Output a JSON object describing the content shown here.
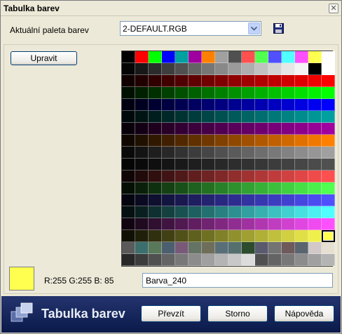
{
  "window": {
    "title": "Tabulka barev",
    "close_icon": "close-icon"
  },
  "palette": {
    "label": "Aktuální paleta barev",
    "value": "2-DEFAULT.RGB",
    "save_icon": "floppy-disk-icon"
  },
  "edit_button": "Upravit",
  "grid": {
    "columns": 16,
    "rows": 18,
    "colors": [
      [
        "#000000",
        "#ff0000",
        "#00ff00",
        "#0000ff",
        "#00a0a0",
        "#a000a0",
        "#ff8000",
        "#a0a0a0",
        "#505050",
        "#ff5050",
        "#50ff50",
        "#5050ff",
        "#50ffff",
        "#ff50ff",
        "#ffff50",
        "#ffffff"
      ],
      [
        "#050505",
        "#181818",
        "#2b2b2b",
        "#3d3d3d",
        "#505050",
        "#636363",
        "#767676",
        "#888888",
        "#9b9b9b",
        "#aeaeae",
        "#c1c1c1",
        "#d3d3d3",
        "#e6e6e6",
        "#f4f4f4",
        "#000000",
        "#ffffff"
      ],
      [
        "#100000",
        "#200000",
        "#300000",
        "#400000",
        "#500000",
        "#600000",
        "#700000",
        "#800000",
        "#900000",
        "#a00000",
        "#b00000",
        "#c00000",
        "#d00000",
        "#e00000",
        "#f00000",
        "#ff0000"
      ],
      [
        "#001000",
        "#002000",
        "#003000",
        "#004000",
        "#005000",
        "#006000",
        "#007000",
        "#008000",
        "#009000",
        "#00a000",
        "#00b000",
        "#00c000",
        "#00d000",
        "#00e000",
        "#00f000",
        "#00ff00"
      ],
      [
        "#000010",
        "#000020",
        "#000030",
        "#000040",
        "#000050",
        "#000060",
        "#000070",
        "#000080",
        "#000090",
        "#0000a0",
        "#0000b0",
        "#0000c0",
        "#0000d0",
        "#0000e0",
        "#0000f0",
        "#0000ff"
      ],
      [
        "#000a0a",
        "#001414",
        "#001e1e",
        "#002828",
        "#003232",
        "#003c3c",
        "#004646",
        "#005050",
        "#005a5a",
        "#006464",
        "#006e6e",
        "#007878",
        "#008282",
        "#008c8c",
        "#009696",
        "#00a0a0"
      ],
      [
        "#0a000a",
        "#140014",
        "#1e001e",
        "#280028",
        "#320032",
        "#3c003c",
        "#460046",
        "#500050",
        "#5a005a",
        "#640064",
        "#6e006e",
        "#780078",
        "#820082",
        "#8c008c",
        "#960096",
        "#a000a0"
      ],
      [
        "#100800",
        "#201000",
        "#301800",
        "#402000",
        "#502800",
        "#603000",
        "#703800",
        "#804000",
        "#904800",
        "#a05000",
        "#b05800",
        "#c06000",
        "#d06800",
        "#e07000",
        "#f07800",
        "#ff8000"
      ],
      [
        "#0a0a0a",
        "#141414",
        "#1e1e1e",
        "#282828",
        "#323232",
        "#3c3c3c",
        "#464646",
        "#505050",
        "#5a5a5a",
        "#646464",
        "#6e6e6e",
        "#787878",
        "#828282",
        "#8c8c8c",
        "#969696",
        "#a0a0a0"
      ],
      [
        "#050505",
        "#0a0a0a",
        "#0f0f0f",
        "#141414",
        "#191919",
        "#1e1e1e",
        "#232323",
        "#282828",
        "#2d2d2d",
        "#323232",
        "#373737",
        "#3c3c3c",
        "#414141",
        "#464646",
        "#4b4b4b",
        "#505050"
      ],
      [
        "#100505",
        "#200a0a",
        "#300f0f",
        "#401414",
        "#501919",
        "#601e1e",
        "#702323",
        "#802828",
        "#902d2d",
        "#a03232",
        "#b03737",
        "#c03c3c",
        "#d04141",
        "#e04646",
        "#f04b4b",
        "#ff5050"
      ],
      [
        "#051005",
        "#0a200a",
        "#0f300f",
        "#144014",
        "#195019",
        "#1e601e",
        "#237023",
        "#288028",
        "#2d902d",
        "#32a032",
        "#37b037",
        "#3cc03c",
        "#41d041",
        "#46e046",
        "#4bf04b",
        "#50ff50"
      ],
      [
        "#050510",
        "#0a0a20",
        "#0f0f30",
        "#141440",
        "#191950",
        "#1e1e60",
        "#232370",
        "#282880",
        "#2d2d90",
        "#3232a0",
        "#3737b0",
        "#3c3cc0",
        "#4141d0",
        "#4646e0",
        "#4b4bf0",
        "#5050ff"
      ],
      [
        "#051010",
        "#0a2020",
        "#0f3030",
        "#144040",
        "#195050",
        "#1e6060",
        "#237070",
        "#288080",
        "#2d9090",
        "#32a0a0",
        "#37b0b0",
        "#3cc0c0",
        "#41d0d0",
        "#46e0e0",
        "#4bf0f0",
        "#50ffff"
      ],
      [
        "#100510",
        "#200a20",
        "#300f30",
        "#401440",
        "#501950",
        "#601e60",
        "#702370",
        "#802880",
        "#902d90",
        "#a032a0",
        "#b037b0",
        "#c03cc0",
        "#d041d0",
        "#e046e0",
        "#f04bf0",
        "#ff50ff"
      ],
      [
        "#101005",
        "#20200a",
        "#30300f",
        "#404014",
        "#505019",
        "#60601e",
        "#707023",
        "#808028",
        "#90902d",
        "#a0a032",
        "#b0b037",
        "#c0c03c",
        "#d0d041",
        "#e0e046",
        "#f0f04b",
        "#ffff50"
      ],
      [
        "#5a5a5a",
        "#3c6e6e",
        "#5a785a",
        "#4b5f6e",
        "#785a78",
        "#647364",
        "#6e6e5a",
        "#5a6e78",
        "#556e6e",
        "#2d4b2d",
        "#5a5a6e",
        "#737373",
        "#6e5a5a",
        "#5a646e",
        "#d2c8c8",
        "#e6e0d2"
      ],
      [
        "#282828",
        "#3c3c3c",
        "#505050",
        "#646464",
        "#787878",
        "#8c8c8c",
        "#a0a0a0",
        "#b4b4b4",
        "#c8c8c8",
        "#dcdcdc",
        "#505050",
        "#646464",
        "#787878",
        "#8c8c8c",
        "#a0a0a0",
        "#b4b4b4"
      ]
    ],
    "selected": {
      "row": 15,
      "col": 15
    }
  },
  "selection": {
    "color": "#ffff50",
    "rgb_text": "R:255  G:255  B: 85",
    "name": "Barva_240"
  },
  "footer": {
    "title": "Tabulka barev",
    "ok": "Převzít",
    "cancel": "Storno",
    "help": "Nápověda"
  }
}
